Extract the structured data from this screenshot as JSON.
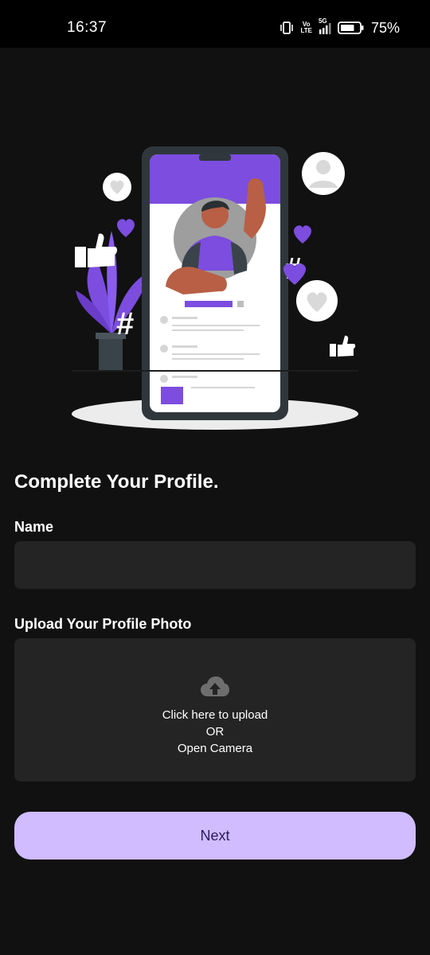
{
  "status_bar": {
    "time": "16:37",
    "network_top": "Vo",
    "network_bottom": "LTE",
    "signal_label": "5G",
    "battery_percent": "75%",
    "battery_level": 0.75
  },
  "illustration": {
    "icon": "profile-illustration",
    "accent_color": "#7c4ddf"
  },
  "form": {
    "title": "Complete Your Profile.",
    "name_label": "Name",
    "name_value": "",
    "photo_label": "Upload Your Profile Photo",
    "upload_line1": "Click here to upload",
    "upload_line2": "OR",
    "upload_line3": "Open Camera",
    "upload_icon": "cloud-upload-icon"
  },
  "actions": {
    "next_label": "Next",
    "next_color": "#d0bcff"
  }
}
